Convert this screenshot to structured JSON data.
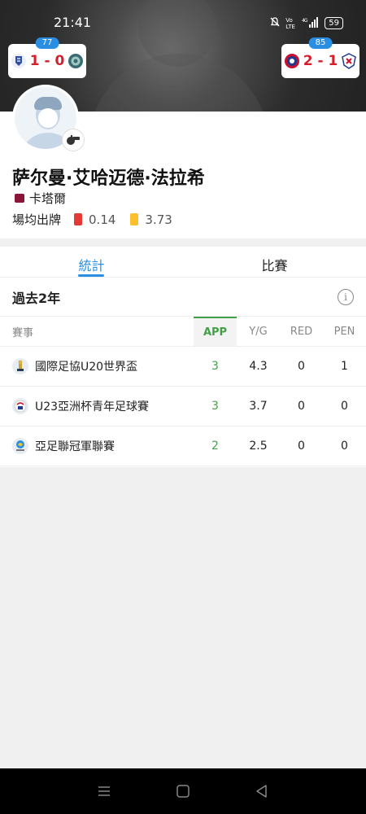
{
  "status_bar": {
    "time": "21:41",
    "network": "4G",
    "volte": "Vo LTE",
    "battery": "59"
  },
  "matches": [
    {
      "rating": "77",
      "score": "1 - 0",
      "home_logo_color": "#2e4fa0",
      "away_logo_color": "#3a6b74"
    },
    {
      "rating": "85",
      "score": "2 - 1",
      "home_logo_color": "#c8102e",
      "away_logo_color": "#1d3c8f"
    }
  ],
  "player": {
    "name": "萨尔曼·艾哈迈德·法拉希",
    "nation": "卡塔爾",
    "nation_flag_color": "#8a1538",
    "cards_label": "場均出牌",
    "red_per_game": "0.14",
    "yellow_per_game": "3.73"
  },
  "tabs": [
    {
      "label": "統計",
      "active": true
    },
    {
      "label": "比賽",
      "active": false
    }
  ],
  "stats": {
    "period": "過去2年",
    "columns": [
      "賽事",
      "APP",
      "Y/G",
      "RED",
      "PEN"
    ],
    "rows": [
      {
        "competition": "國際足協U20世界盃",
        "icon": "trophy-icon",
        "app": "3",
        "yg": "4.3",
        "red": "0",
        "pen": "1"
      },
      {
        "competition": "U23亞洲杯青年足球賽",
        "icon": "afc-u23-icon",
        "app": "3",
        "yg": "3.7",
        "red": "0",
        "pen": "0"
      },
      {
        "competition": "亞足聯冠軍聯賽",
        "icon": "afc-cl-icon",
        "app": "2",
        "yg": "2.5",
        "red": "0",
        "pen": "0"
      }
    ]
  },
  "colors": {
    "accent_blue": "#2a8ee2",
    "app_green": "#43a047",
    "score_red": "#d4202e",
    "red_card": "#e53935",
    "yellow_card": "#fbc02d"
  }
}
